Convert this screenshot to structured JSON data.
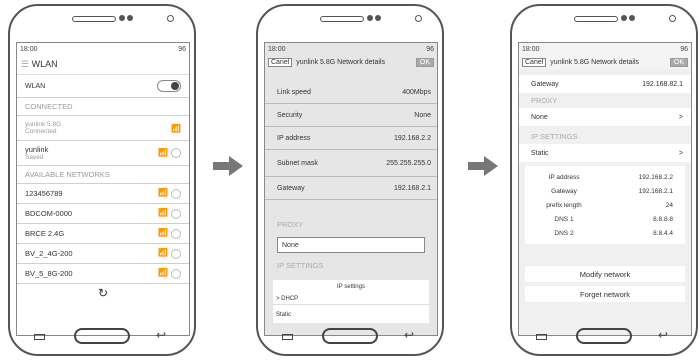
{
  "status": {
    "time": "18:00",
    "battery": "96"
  },
  "screen1": {
    "title": "WLAN",
    "wlan_toggle_label": "WLAN",
    "connected_header": "CONNECTED",
    "connected_net": {
      "name": "yunlink 5.8G",
      "status": "Connected"
    },
    "saved_net": {
      "name": "yunlink",
      "status": "Saved"
    },
    "available_header": "AVAILABLE NETWORKS",
    "networks": [
      "123456789",
      "BDCOM-0000",
      "BRCE 2.4G",
      "BV_2_4G-200",
      "BV_5_8G-200"
    ]
  },
  "screen2": {
    "cancel": "Canel",
    "title": "yunlink 5.8G Network details",
    "ok": "OK",
    "link_speed_label": "Link speed",
    "link_speed": "400Mbps",
    "security_label": "Security",
    "security": "None",
    "ip_label": "IP address",
    "ip": "192.168.2.2",
    "subnet_label": "Subnet mask",
    "subnet": "255.255.255.0",
    "gateway_label": "Gateway",
    "gateway": "192.168.2.1",
    "proxy_header": "PROXY",
    "proxy_value": "None",
    "ip_settings_header": "IP SETTINGS",
    "dropdown_title": "IP settings",
    "dropdown_opt1": "> DHCP",
    "dropdown_opt2": "Static"
  },
  "screen3": {
    "cancel": "Canel",
    "title": "yunlink 5.8G Network details",
    "ok": "OK",
    "gateway_label": "Gateway",
    "gateway": "192.168.82.1",
    "proxy_header": "PROXY",
    "proxy_value": "None",
    "proxy_arrow": ">",
    "ip_settings_header": "IP SETTINGS",
    "ip_settings_value": "Static",
    "ip_settings_arrow": ">",
    "fields": [
      {
        "label": "IP address",
        "value": "192.168.2.2"
      },
      {
        "label": "Gateway",
        "value": "192.168.2.1"
      },
      {
        "label": "prefix length",
        "value": "24"
      },
      {
        "label": "DNS 1",
        "value": "8.8.8.8"
      },
      {
        "label": "DNS 2",
        "value": "8.8.4.4"
      }
    ],
    "modify": "Modify network",
    "forget": "Forget network"
  },
  "icons": {
    "wifi": "wifi-icon",
    "refresh": "refresh-icon",
    "back": "back-icon",
    "menu": "menu-icon",
    "home": "home-icon"
  }
}
